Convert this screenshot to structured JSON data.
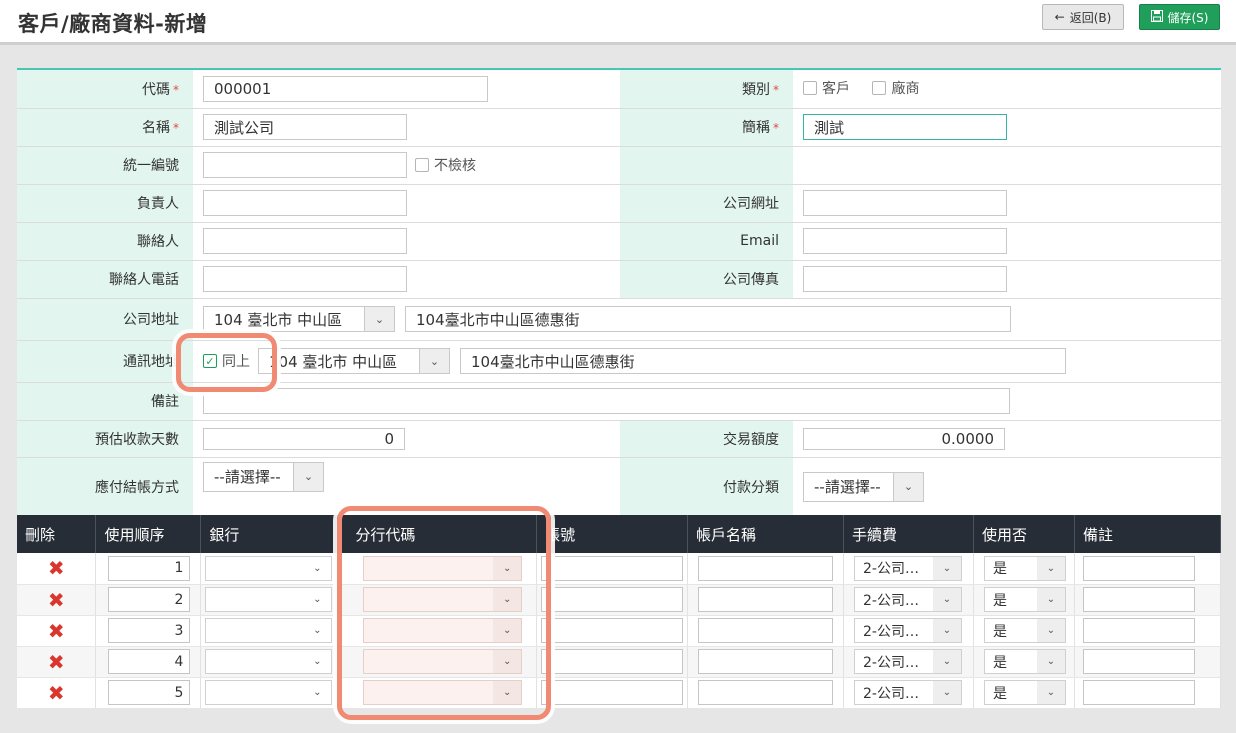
{
  "header": {
    "title": "客戶/廠商資料-新增",
    "back_label": "返回(B)",
    "save_label": "儲存(S)"
  },
  "form": {
    "code": {
      "label": "代碼",
      "value": "000001"
    },
    "category": {
      "label": "類別",
      "options": [
        "客戶",
        "廠商"
      ]
    },
    "name": {
      "label": "名稱",
      "value": "測試公司"
    },
    "short_name": {
      "label": "簡稱",
      "value": "測試"
    },
    "tax_id": {
      "label": "統一編號",
      "value": "",
      "no_check_label": "不檢核"
    },
    "owner": {
      "label": "負責人",
      "value": ""
    },
    "website": {
      "label": "公司網址",
      "value": ""
    },
    "contact": {
      "label": "聯絡人",
      "value": ""
    },
    "email": {
      "label": "Email",
      "value": ""
    },
    "contact_phone": {
      "label": "聯絡人電話",
      "value": ""
    },
    "fax": {
      "label": "公司傳真",
      "value": ""
    },
    "company_address": {
      "label": "公司地址",
      "zip": "104 臺北市 中山區",
      "street": "104臺北市中山區德惠街"
    },
    "mailing_address": {
      "label": "通訊地址",
      "same_label": "同上",
      "zip": "104 臺北市 中山區",
      "street": "104臺北市中山區德惠街"
    },
    "remark": {
      "label": "備註",
      "value": ""
    },
    "est_days": {
      "label": "預估收款天數",
      "value": "0"
    },
    "credit_limit": {
      "label": "交易額度",
      "value": "0.0000"
    },
    "settlement": {
      "label": "應付結帳方式",
      "value": "--請選擇--"
    },
    "payment_type": {
      "label": "付款分類",
      "value": "--請選擇--"
    }
  },
  "grid": {
    "headers": [
      "刪除",
      "使用順序",
      "銀行",
      "分行代碼",
      "帳號",
      "帳戶名稱",
      "手續費",
      "使用否",
      "備註"
    ],
    "rows": [
      {
        "order": "1",
        "fee": "2-公司…",
        "active": "是"
      },
      {
        "order": "2",
        "fee": "2-公司…",
        "active": "是"
      },
      {
        "order": "3",
        "fee": "2-公司…",
        "active": "是"
      },
      {
        "order": "4",
        "fee": "2-公司…",
        "active": "是"
      },
      {
        "order": "5",
        "fee": "2-公司…",
        "active": "是"
      }
    ]
  },
  "colors": {
    "accent": "#47c6b3",
    "label_bg": "#e2f5ee",
    "save": "#1f9f5a",
    "grid_header": "#262d36",
    "highlight": "#f08a72"
  },
  "icons": {
    "back": "arrow-left-icon",
    "save": "floppy-disk-icon",
    "delete": "x-icon",
    "dropdown": "chevron-down-icon"
  }
}
